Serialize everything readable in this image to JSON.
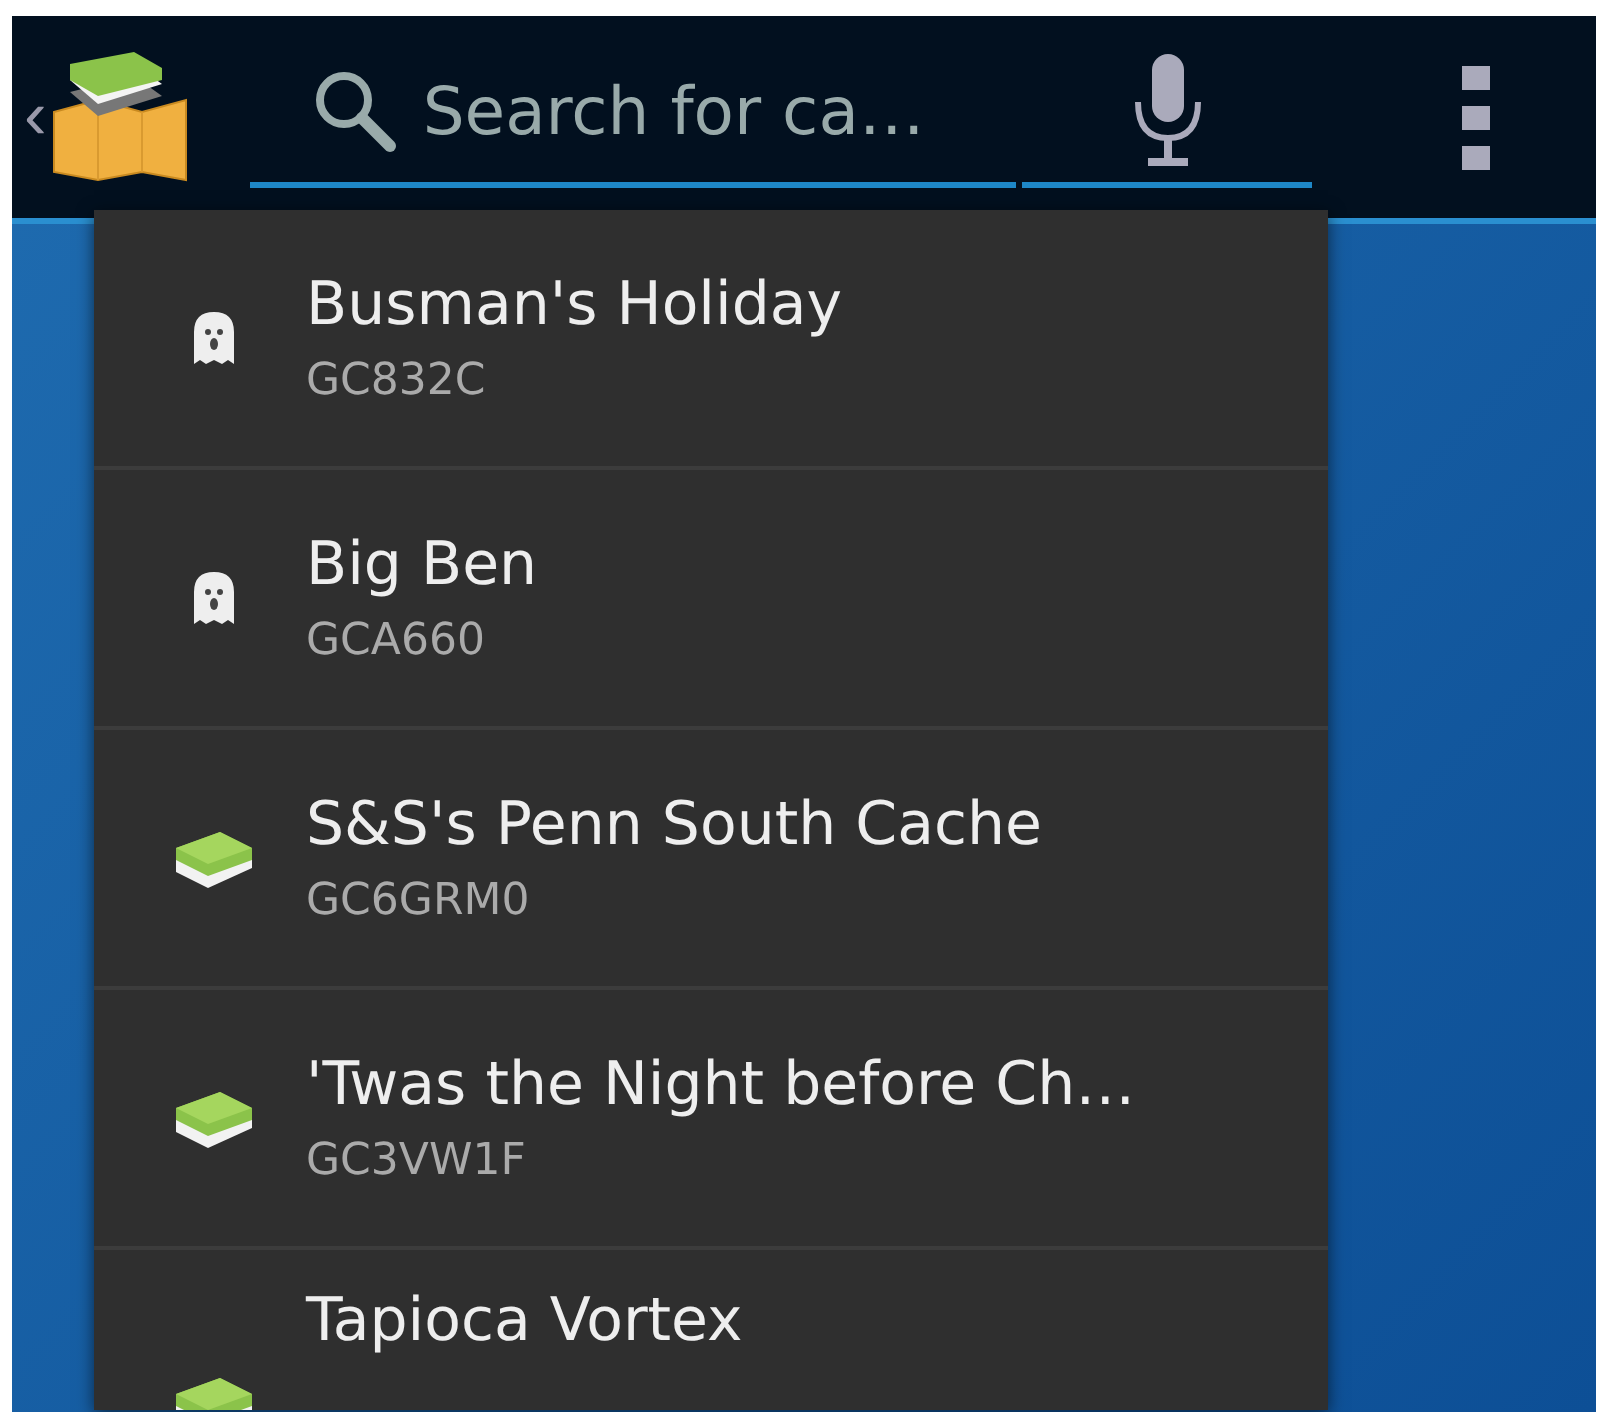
{
  "action_bar": {
    "back": "‹",
    "search": {
      "placeholder": "Search for ca…"
    }
  },
  "suggestions": [
    {
      "kind": "ghost",
      "name": "Busman's Holiday",
      "code": "GC832C"
    },
    {
      "kind": "ghost",
      "name": "Big Ben",
      "code": "GCA660"
    },
    {
      "kind": "cache",
      "name": "S&S's Penn South Cache",
      "code": "GC6GRM0"
    },
    {
      "kind": "cache",
      "name": "'Twas the Night before Ch…",
      "code": "GC3VW1F"
    },
    {
      "kind": "cache",
      "name": "Tapioca Vortex"
    }
  ]
}
